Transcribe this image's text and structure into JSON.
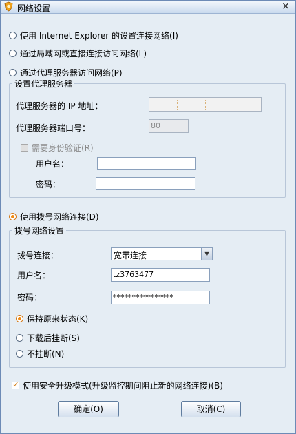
{
  "window": {
    "title": "网络设置",
    "close": "×"
  },
  "conn": {
    "ie": "使用 Internet Explorer 的设置连接网络(I)",
    "lan": "通过局域网或直接连接访问网络(L)",
    "proxy": "通过代理服务器访问网络(P)"
  },
  "proxy_group": {
    "title": "设置代理服务器",
    "ip_label": "代理服务器的 IP 地址：",
    "port_label": "代理服务器端口号：",
    "port_value": "80",
    "auth_label": "需要身份验证(R)",
    "user_label": "用户名：",
    "pass_label": "密码："
  },
  "dial": {
    "radio": "使用拨号网络连接(D)",
    "group_title": "拨号网络设置",
    "conn_label": "拨号连接：",
    "conn_value": "宽带连接",
    "user_label": "用户名：",
    "user_value": "tz3763477",
    "pass_label": "密码：",
    "pass_value": "****************",
    "keep": "保持原来状态(K)",
    "hangup_after": "下载后挂断(S)",
    "no_hangup": "不挂断(N)"
  },
  "safe_mode": "使用安全升级模式(升级监控期间阻止新的网络连接)(B)",
  "buttons": {
    "ok": "确定(O)",
    "cancel": "取消(C)"
  },
  "colors": {
    "accent": "#f08a12",
    "background": "#e5edf4"
  }
}
